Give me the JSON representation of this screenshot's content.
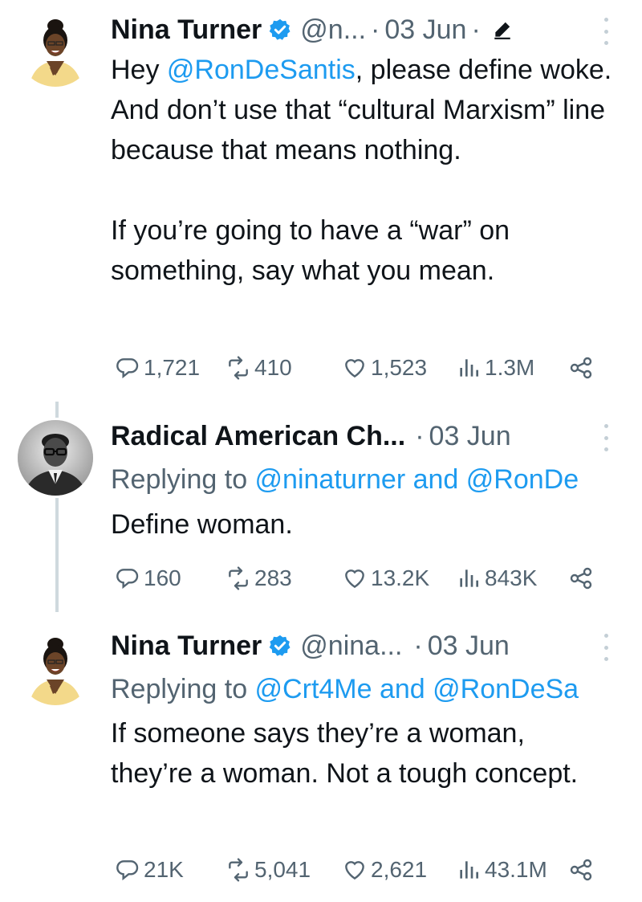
{
  "tweets": [
    {
      "author": "Nina Turner",
      "handle": "@n...",
      "sep1": "·",
      "date": "03 Jun",
      "sep2": "·",
      "body_parts": [
        "Hey ",
        "@RonDeSantis",
        ", please define woke. And don’t use that “cultural Marxism” line because that means nothing."
      ],
      "body_2": "If you’re going to have a “war” on something, say what you mean.",
      "stats": {
        "replies": "1,721",
        "reposts": "410",
        "likes": "1,523",
        "views": "1.3M"
      }
    },
    {
      "author": "Radical American Ch...",
      "sep1": "·",
      "date": "03 Jun",
      "replying_prefix": "Replying to ",
      "replying_user1": "@ninaturner",
      "replying_and": " and ",
      "replying_user2": "@RonDe",
      "body": "Define woman.",
      "stats": {
        "replies": "160",
        "reposts": "283",
        "likes": "13.2K",
        "views": "843K"
      }
    },
    {
      "author": "Nina Turner",
      "handle": "@nina...",
      "sep1": "·",
      "date": "03 Jun",
      "replying_prefix": "Replying to ",
      "replying_user1": "@Crt4Me",
      "replying_and": " and ",
      "replying_user2": "@RonDeSa",
      "body": "If someone says they’re a woman, they’re a woman. Not a tough concept.",
      "stats": {
        "replies": "21K",
        "reposts": "5,041",
        "likes": "2,621",
        "views": "43.1M"
      }
    }
  ],
  "colors": {
    "link": "#1d9bf0",
    "muted": "#536471",
    "verified": "#1d9bf0",
    "text": "#0f1419"
  }
}
